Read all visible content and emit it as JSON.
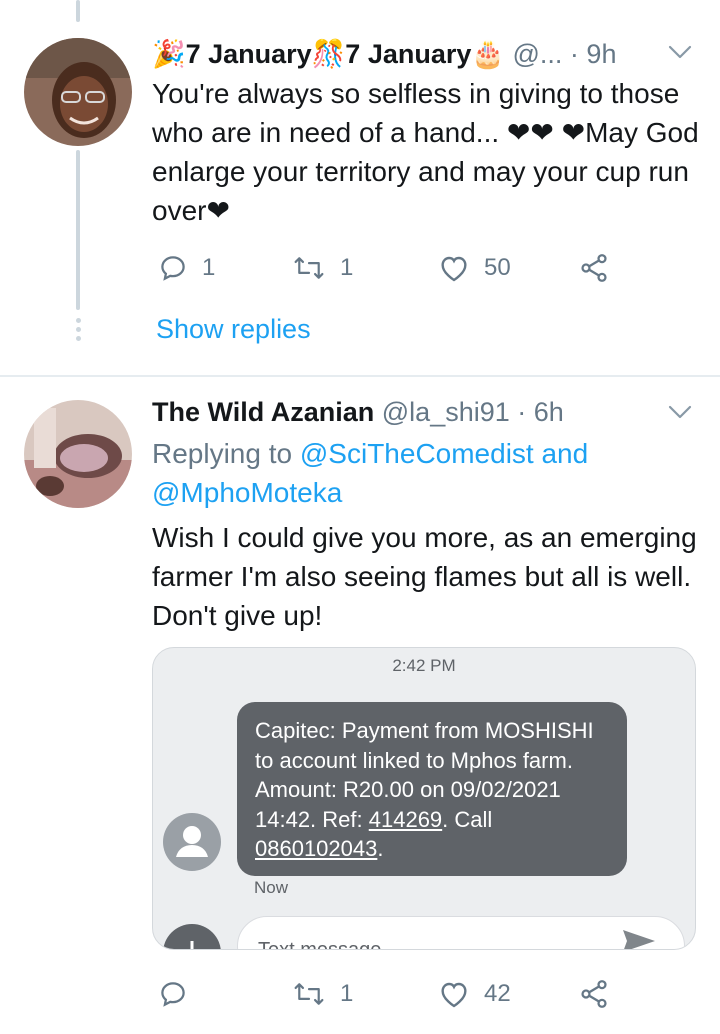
{
  "tweets": [
    {
      "name": "🎉7 January🎊7 January🎂",
      "handle_time": " @... · 9h",
      "text": "You're always so selfless in giving to those who are in need of a hand... ❤❤ ❤May God enlarge your territory and may your cup run over❤",
      "reply_count": "1",
      "retweet_count": "1",
      "like_count": "50",
      "show_replies": "Show replies"
    },
    {
      "name": "The Wild Azanian",
      "handle_time": " @la_shi91 · 6h",
      "replying_prefix": "Replying to ",
      "replying_handles": "@SciTheComedist and @MphoMoteka",
      "text": "Wish I could give you more, as an emerging farmer I'm also seeing flames but all is well. Don't give up!",
      "reply_count": "",
      "retweet_count": "1",
      "like_count": "42"
    }
  ],
  "sms_screenshot": {
    "time": "2:42 PM",
    "message_pre": "Capitec: Payment from MOSHISHI to account linked to Mphos farm. Amount: R20.00 on 09/02/2021 14:42. Ref: ",
    "ref_number": "414269",
    "message_mid": ". Call ",
    "phone": "0860102043",
    "message_end": ".",
    "status": "Now",
    "input_placeholder": "Text message"
  },
  "colors": {
    "accent": "#1da1f2",
    "secondary_text": "#657786",
    "heart": "#e0245e",
    "bubble": "#5f6368"
  }
}
